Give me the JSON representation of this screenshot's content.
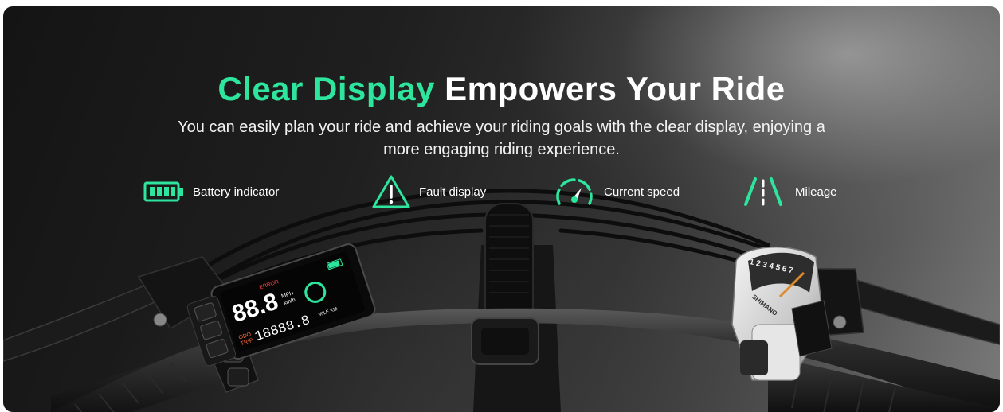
{
  "headline": {
    "accent": "Clear Display",
    "rest": "Empowers Your Ride"
  },
  "subtitle": "You can easily plan your ride and achieve your riding goals with the clear display, enjoying a more engaging riding experience.",
  "features": [
    {
      "icon": "battery-icon",
      "label": "Battery indicator"
    },
    {
      "icon": "warning-triangle-icon",
      "label": "Fault display"
    },
    {
      "icon": "speedometer-icon",
      "label": "Current speed"
    },
    {
      "icon": "road-icon",
      "label": "Mileage"
    }
  ],
  "lcd": {
    "speed": "88.8",
    "unit_top": "MPH",
    "unit_bottom": "km/h",
    "mileage": "18888.8",
    "odo": "ODO",
    "trip": "TRIP",
    "distance_unit": "MILE KM"
  },
  "shifter": {
    "gears": "1 2 3 4 5 6 7",
    "brand": "SHIMANO"
  },
  "colors": {
    "accent": "#2ee59d",
    "text": "#ffffff"
  }
}
